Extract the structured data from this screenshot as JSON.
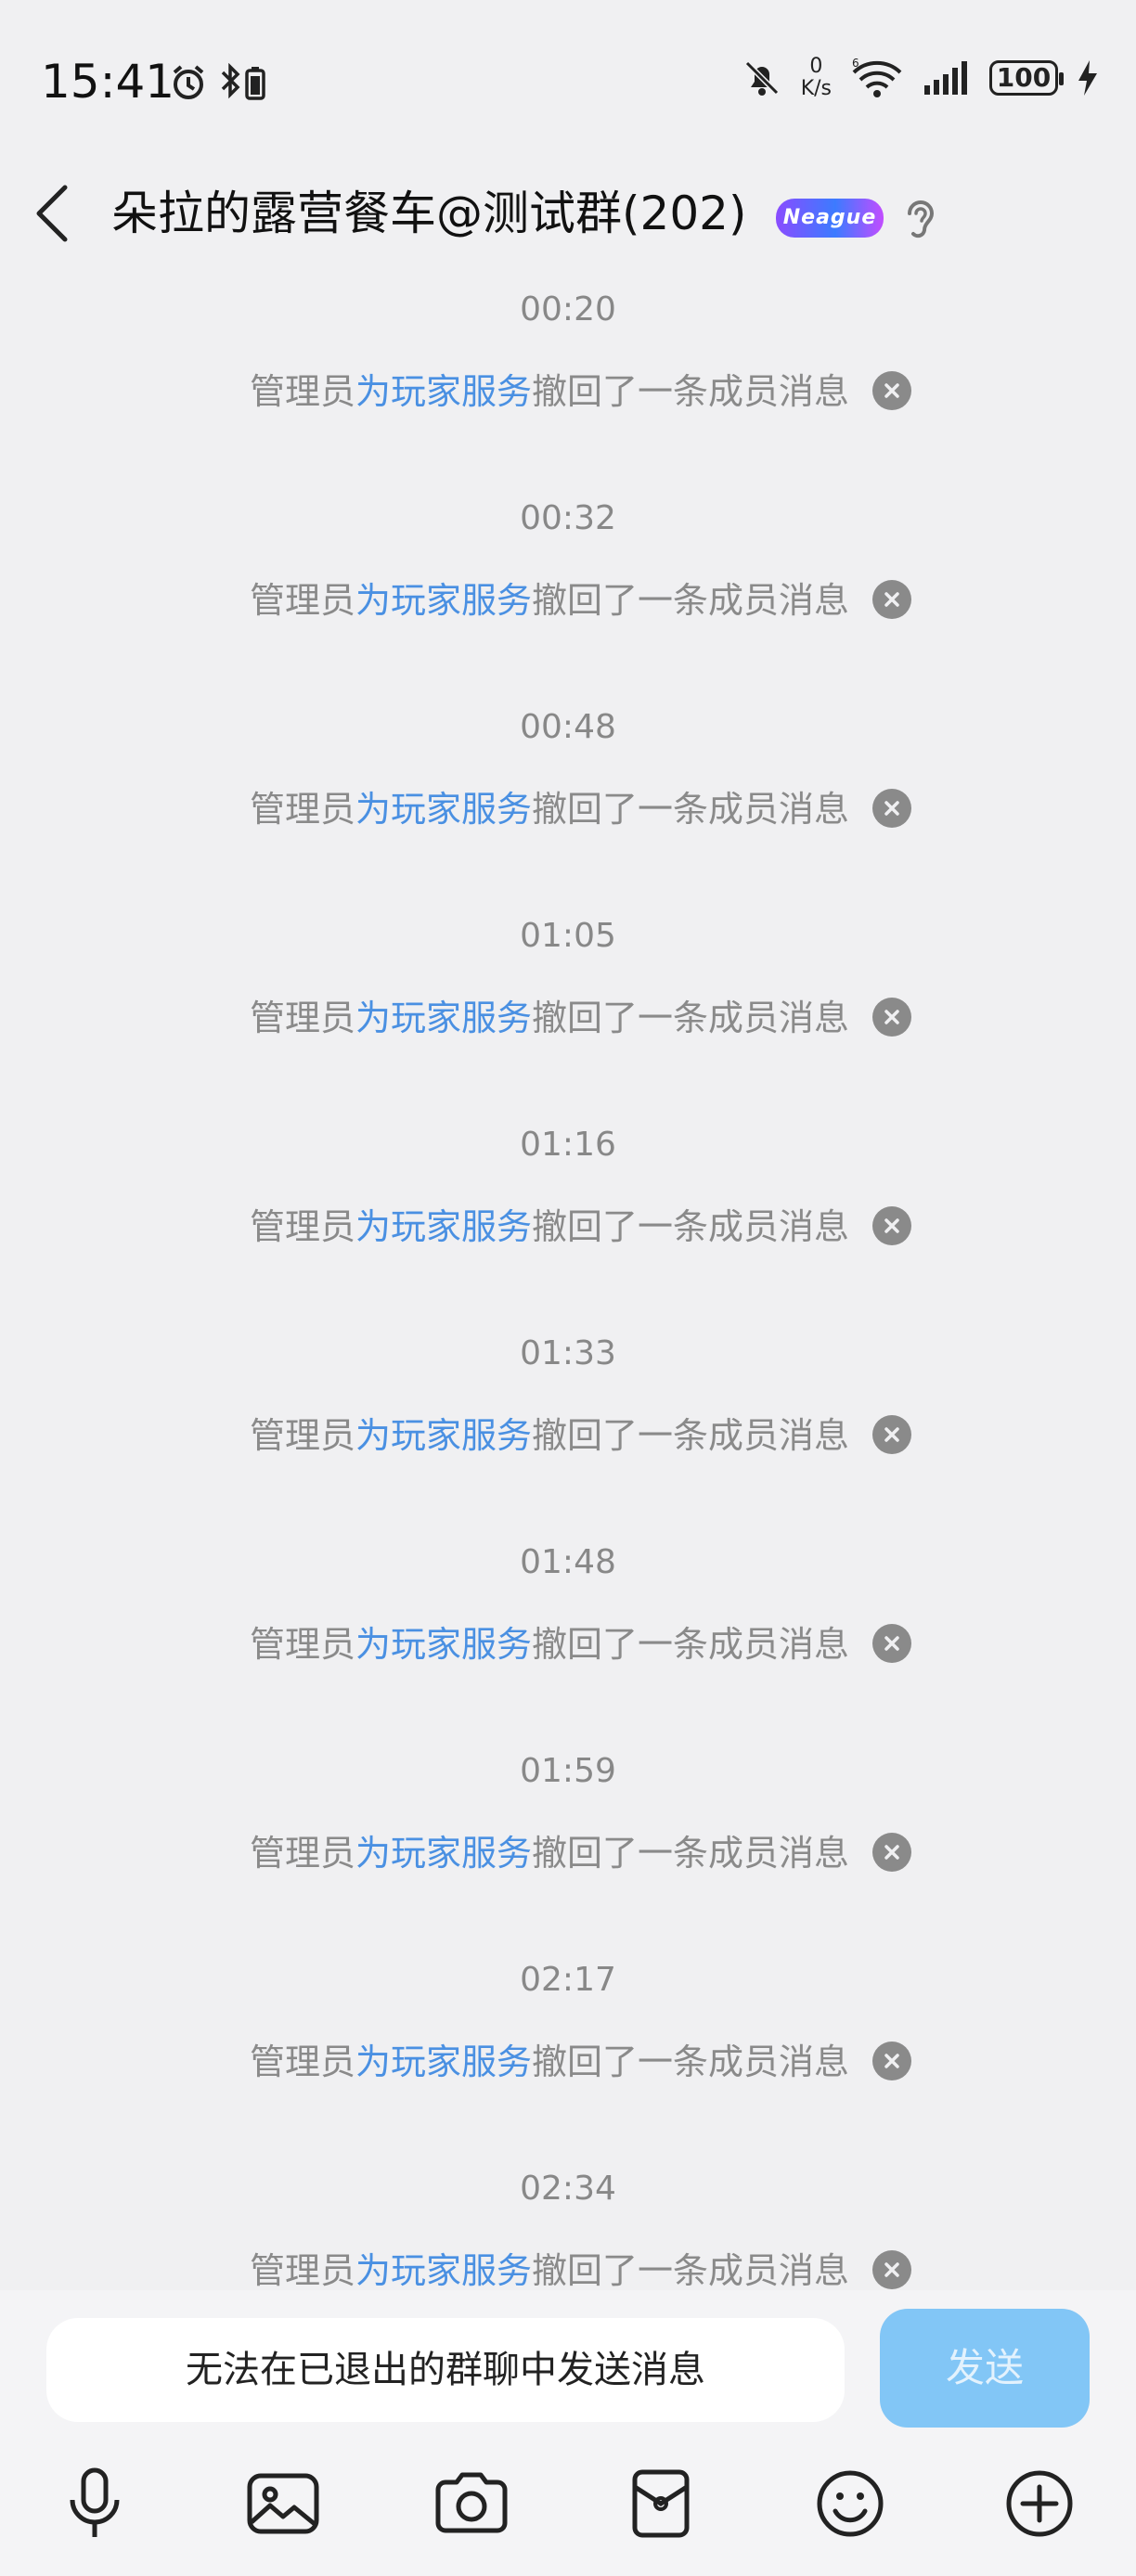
{
  "status_bar": {
    "time": "15:41",
    "net_speed_value": "0",
    "net_speed_unit": "K/s",
    "battery": "100"
  },
  "header": {
    "title": "朵拉的露营餐车@测试群(202)",
    "badge_text": "Neague"
  },
  "messages": [
    {
      "time": "00:20",
      "prefix": "管理员",
      "admin": "为玩家服务",
      "suffix": "撤回了一条成员消息"
    },
    {
      "time": "00:32",
      "prefix": "管理员",
      "admin": "为玩家服务",
      "suffix": "撤回了一条成员消息"
    },
    {
      "time": "00:48",
      "prefix": "管理员",
      "admin": "为玩家服务",
      "suffix": "撤回了一条成员消息"
    },
    {
      "time": "01:05",
      "prefix": "管理员",
      "admin": "为玩家服务",
      "suffix": "撤回了一条成员消息"
    },
    {
      "time": "01:16",
      "prefix": "管理员",
      "admin": "为玩家服务",
      "suffix": "撤回了一条成员消息"
    },
    {
      "time": "01:33",
      "prefix": "管理员",
      "admin": "为玩家服务",
      "suffix": "撤回了一条成员消息"
    },
    {
      "time": "01:48",
      "prefix": "管理员",
      "admin": "为玩家服务",
      "suffix": "撤回了一条成员消息"
    },
    {
      "time": "01:59",
      "prefix": "管理员",
      "admin": "为玩家服务",
      "suffix": "撤回了一条成员消息"
    },
    {
      "time": "02:17",
      "prefix": "管理员",
      "admin": "为玩家服务",
      "suffix": "撤回了一条成员消息"
    },
    {
      "time": "02:34",
      "prefix": "管理员",
      "admin": "为玩家服务",
      "suffix": "撤回了一条成员消息"
    }
  ],
  "input": {
    "disabled_text": "无法在已退出的群聊中发送消息",
    "send_label": "发送"
  },
  "toolbar_icons": [
    "microphone-icon",
    "image-icon",
    "camera-icon",
    "red-packet-icon",
    "emoji-icon",
    "plus-icon"
  ],
  "colors": {
    "accent_link": "#4a90e2",
    "send_button": "#82c6f6",
    "background": "#f0f0f2"
  }
}
